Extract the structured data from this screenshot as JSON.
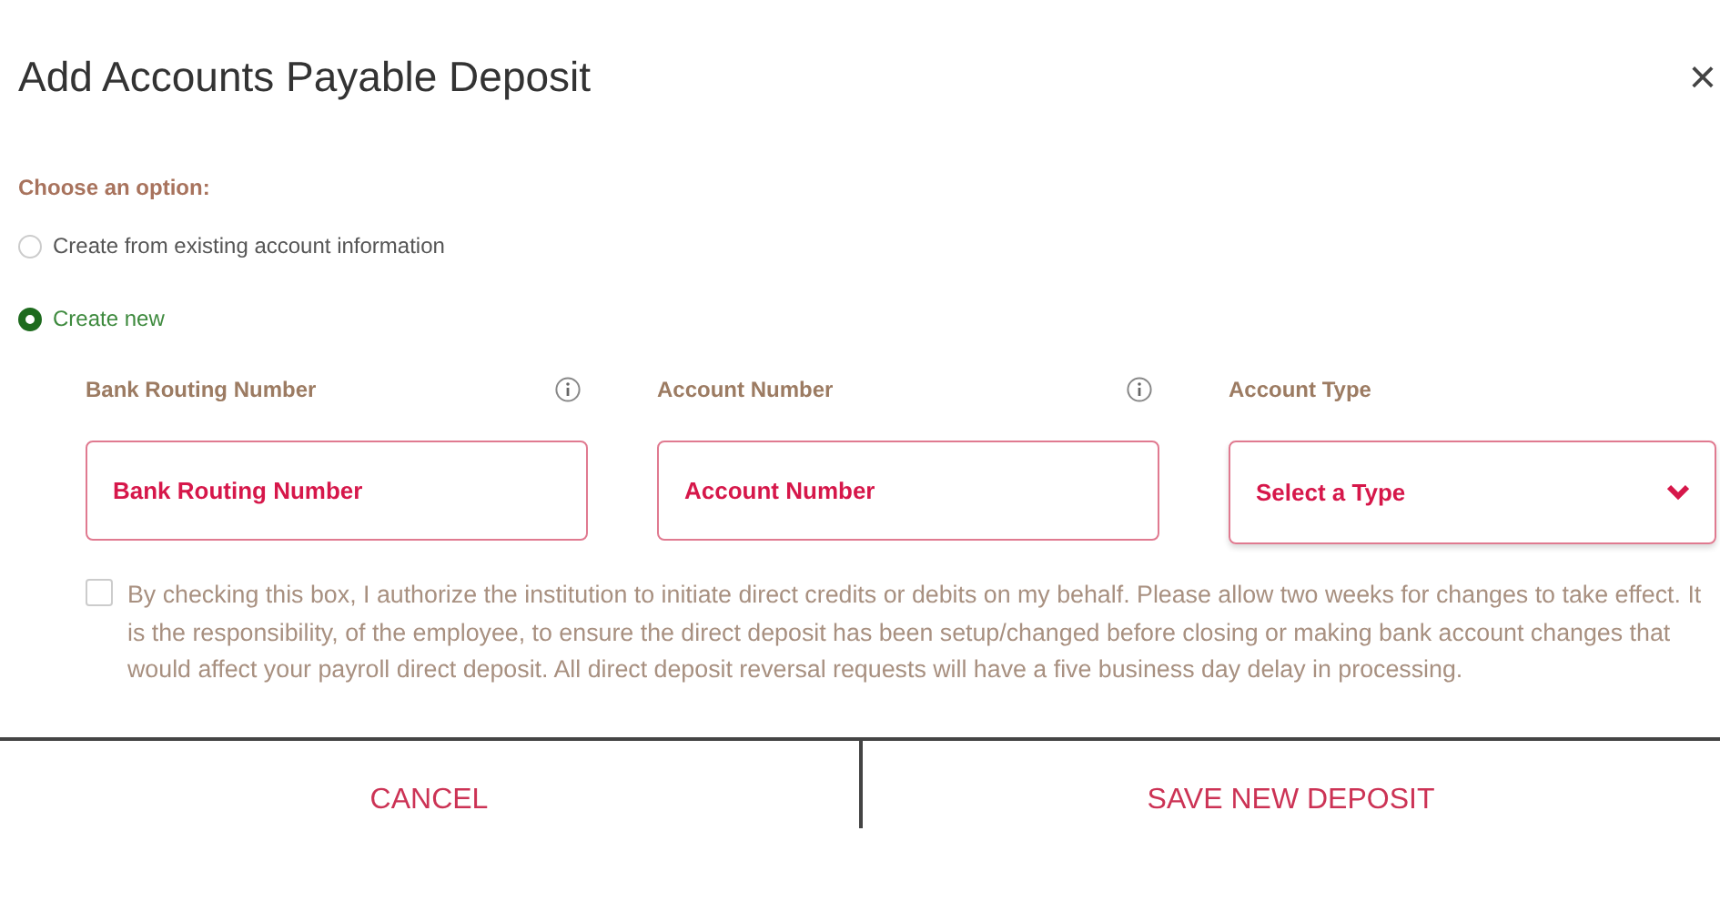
{
  "dialog": {
    "title": "Add Accounts Payable Deposit",
    "close": "×"
  },
  "option_heading": "Choose an option:",
  "options": [
    {
      "label": "Create from existing account information",
      "selected": false
    },
    {
      "label": "Create new",
      "selected": true
    }
  ],
  "fields": [
    {
      "kind": "input",
      "label": "Bank Routing Number",
      "info": true,
      "placeholder": "Bank Routing Number"
    },
    {
      "kind": "input",
      "label": "Account Number",
      "info": true,
      "placeholder": "Account Number"
    },
    {
      "kind": "select",
      "label": "Account Type",
      "info": false,
      "value": "Select a Type"
    }
  ],
  "authorization": {
    "checked": false,
    "text": "By checking this box, I authorize the institution to initiate direct credits or debits on my behalf. Please allow two weeks for changes to take effect. It is the responsibility, of the employee, to ensure the direct deposit has been setup/changed before closing or making bank account changes that would affect your payroll direct deposit. All direct deposit reversal requests will have a five business day delay in processing."
  },
  "buttons": [
    "CANCEL",
    "SAVE NEW DEPOSIT"
  ]
}
